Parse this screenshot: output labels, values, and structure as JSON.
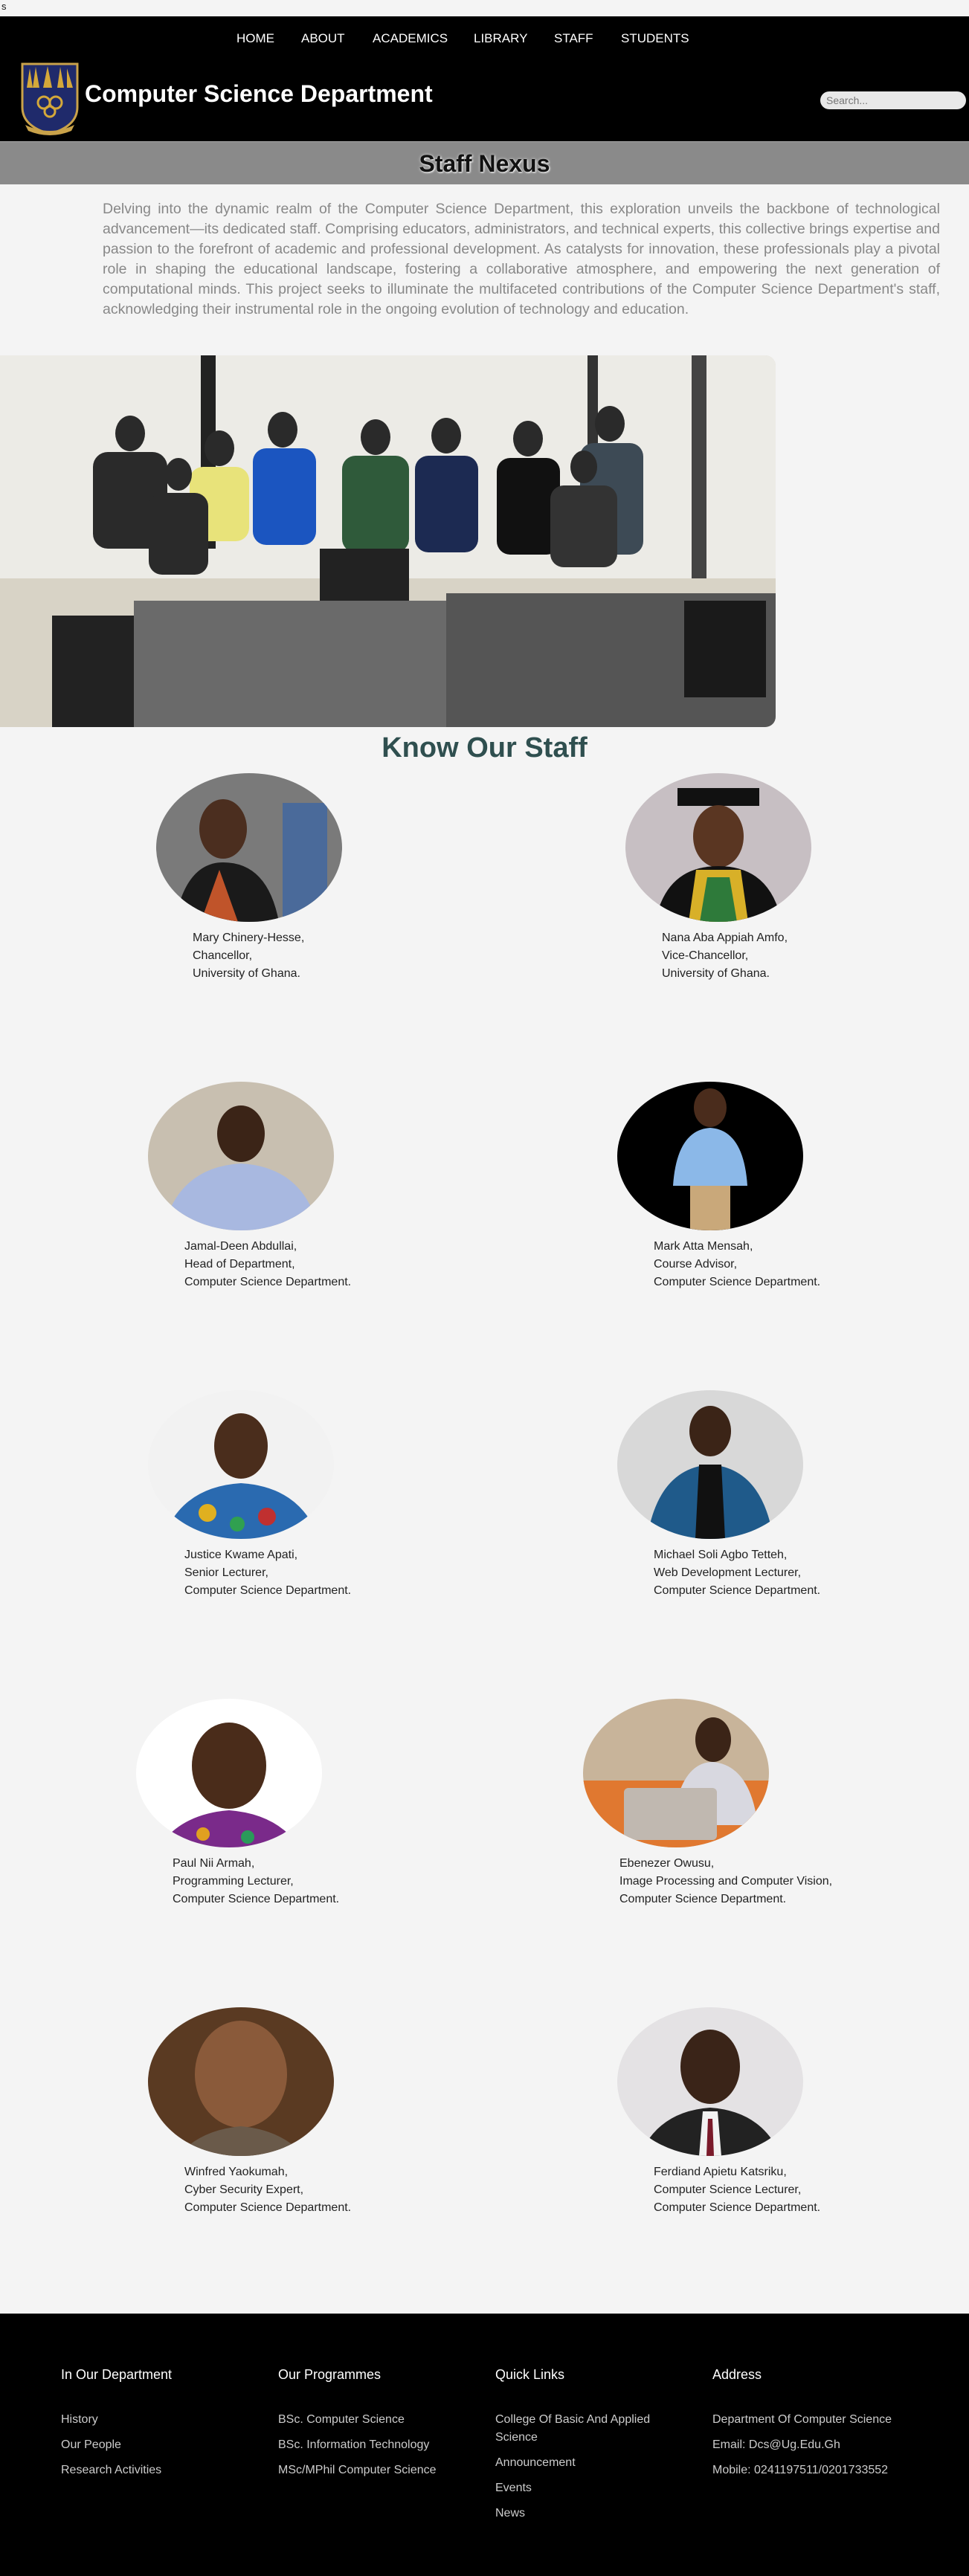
{
  "topline": "s",
  "nav": {
    "items": [
      "HOME",
      "ABOUT",
      "ACADEMICS",
      "LIBRARY",
      "STAFF",
      "STUDENTS"
    ]
  },
  "header": {
    "title": "Computer Science Department",
    "search_placeholder": "Search..."
  },
  "banner": {
    "title": "Staff Nexus"
  },
  "intro": "Delving into the dynamic realm of the Computer Science Department, this exploration unveils the backbone of technological advancement—its dedicated staff. Comprising educators, administrators, and technical experts, this collective brings expertise and passion to the forefront of academic and professional development. As catalysts for innovation, these professionals play a pivotal role in shaping the educational landscape, fostering a collaborative atmosphere, and empowering the next generation of computational minds. This project seeks to illuminate the multifaceted contributions of the Computer Science Department's staff, acknowledging their instrumental role in the ongoing evolution of technology and education.",
  "staff_heading": "Know Our Staff",
  "staff": [
    {
      "name": "Mary Chinery-Hesse,",
      "role": "Chancellor,",
      "org": "University of Ghana."
    },
    {
      "name": "Nana Aba Appiah Amfo,",
      "role": "Vice-Chancellor,",
      "org": "University of Ghana."
    },
    {
      "name": "Jamal-Deen Abdullai,",
      "role": "Head of Department,",
      "org": "Computer Science Department."
    },
    {
      "name": "Mark Atta Mensah,",
      "role": "Course Advisor,",
      "org": "Computer Science Department."
    },
    {
      "name": "Justice Kwame Apati,",
      "role": "Senior Lecturer,",
      "org": "Computer Science Department."
    },
    {
      "name": "Michael Soli Agbo Tetteh,",
      "role": "Web Development Lecturer,",
      "org": "Computer Science Department."
    },
    {
      "name": "Paul Nii Armah,",
      "role": "Programming Lecturer,",
      "org": "Computer Science Department."
    },
    {
      "name": "Ebenezer Owusu,",
      "role": "Image Processing and Computer Vision,",
      "org": "Computer Science Department."
    },
    {
      "name": "Winfred Yaokumah,",
      "role": "Cyber Security Expert,",
      "org": "Computer Science Department."
    },
    {
      "name": "Ferdiand Apietu Katsriku,",
      "role": "Computer Science Lecturer,",
      "org": "Computer Science Department."
    }
  ],
  "footer": {
    "department": {
      "heading": "In Our Department",
      "links": [
        "History",
        "Our People",
        "Research Activities"
      ]
    },
    "programmes": {
      "heading": "Our Programmes",
      "links": [
        "BSc. Computer Science",
        "BSc. Information Technology",
        "MSc/MPhil Computer Science"
      ]
    },
    "quick_links": {
      "heading": "Quick Links",
      "links": [
        "College Of Basic And Applied Science",
        "Announcement",
        "Events",
        "News"
      ]
    },
    "address": {
      "heading": "Address",
      "lines": [
        "Department Of Computer Science",
        "Email: Dcs@Ug.Edu.Gh",
        "Mobile: 0241197511/0201733552"
      ]
    }
  },
  "colors": {
    "header_bg": "#000000",
    "banner_bg": "#8a8a8a",
    "heading": "#2f4f4f",
    "page_bg": "#f4f4f4"
  }
}
